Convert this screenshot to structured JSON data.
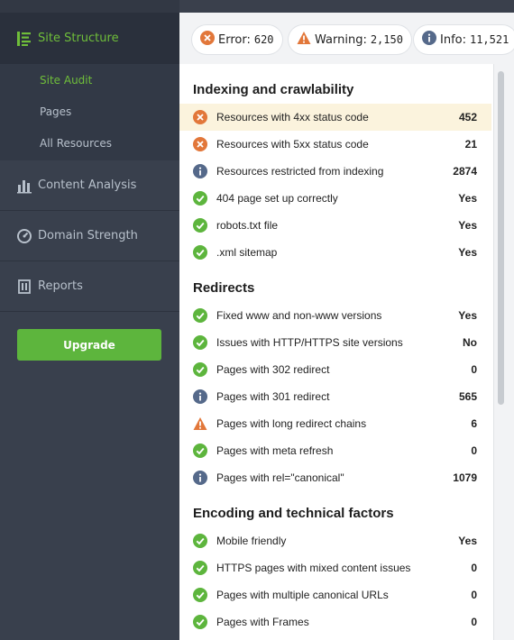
{
  "sidebar": {
    "top_item": {
      "label": "Site Structure",
      "icon": "site-structure-icon",
      "color": "#6fbe3a"
    },
    "sub_items": [
      {
        "label": "Site Audit",
        "active": true
      },
      {
        "label": "Pages",
        "active": false
      },
      {
        "label": "All Resources",
        "active": false
      }
    ],
    "items": [
      {
        "label": "Content Analysis",
        "icon": "content-analysis-icon"
      },
      {
        "label": "Domain Strength",
        "icon": "domain-strength-icon"
      },
      {
        "label": "Reports",
        "icon": "reports-icon"
      }
    ],
    "upgrade_label": "Upgrade"
  },
  "summary": {
    "error": {
      "label": "Error:",
      "count": "620",
      "color": "#e2773a"
    },
    "warning": {
      "label": "Warning:",
      "count": "2,150",
      "color": "#e2773a"
    },
    "info": {
      "label": "Info:",
      "count": "11,521",
      "color": "#55698a"
    }
  },
  "sections": [
    {
      "title": "Indexing and crawlability",
      "rows": [
        {
          "label": "Resources with 4xx status code",
          "value": "452",
          "status": "error",
          "highlight": true
        },
        {
          "label": "Resources with 5xx status code",
          "value": "21",
          "status": "error"
        },
        {
          "label": "Resources restricted from indexing",
          "value": "2874",
          "status": "info"
        },
        {
          "label": "404 page set up correctly",
          "value": "Yes",
          "status": "ok"
        },
        {
          "label": "robots.txt file",
          "value": "Yes",
          "status": "ok"
        },
        {
          "label": ".xml sitemap",
          "value": "Yes",
          "status": "ok"
        }
      ]
    },
    {
      "title": "Redirects",
      "rows": [
        {
          "label": "Fixed www and non-www versions",
          "value": "Yes",
          "status": "ok"
        },
        {
          "label": "Issues with HTTP/HTTPS site versions",
          "value": "No",
          "status": "ok"
        },
        {
          "label": "Pages with 302 redirect",
          "value": "0",
          "status": "ok"
        },
        {
          "label": "Pages with 301 redirect",
          "value": "565",
          "status": "info"
        },
        {
          "label": "Pages with long redirect chains",
          "value": "6",
          "status": "warning"
        },
        {
          "label": "Pages with meta refresh",
          "value": "0",
          "status": "ok"
        },
        {
          "label": "Pages with rel=\"canonical\"",
          "value": "1079",
          "status": "info"
        }
      ]
    },
    {
      "title": "Encoding and technical factors",
      "rows": [
        {
          "label": "Mobile friendly",
          "value": "Yes",
          "status": "ok"
        },
        {
          "label": "HTTPS pages with mixed content issues",
          "value": "0",
          "status": "ok"
        },
        {
          "label": "Pages with multiple canonical URLs",
          "value": "0",
          "status": "ok"
        },
        {
          "label": "Pages with Frames",
          "value": "0",
          "status": "ok"
        }
      ]
    }
  ],
  "colors": {
    "ok": "#5db53d",
    "error": "#e2773a",
    "warning": "#e2773a",
    "info": "#55698a",
    "highlight": "#fbf3dd"
  }
}
